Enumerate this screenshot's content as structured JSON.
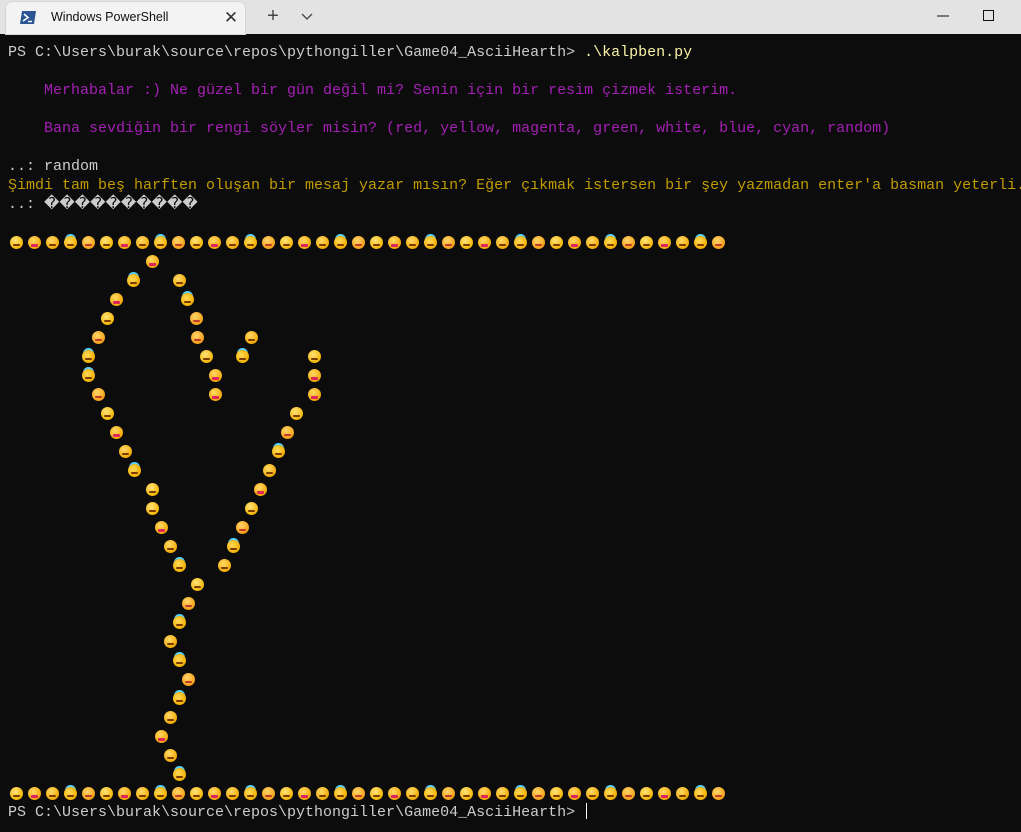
{
  "window": {
    "tab_title": "Windows PowerShell",
    "close_tab_label": "✕",
    "new_tab_label": "+",
    "icons": {
      "tab": "powershell-icon",
      "dropdown": "chevron-down-icon",
      "minimize": "minimize-icon",
      "maximize": "maximize-icon"
    }
  },
  "terminal": {
    "prompt_1": "PS C:\\Users\\burak\\source\\repos\\pythongiller\\Game04_AsciiHearth> ",
    "command": ".\\kalpben.py",
    "greeting": "    Merhabalar :) Ne güzel bir gün değil mi? Senin için bir resim çizmek isterim.",
    "color_question": "    Bana sevdiğin bir rengi söyler misin? (red, yellow, magenta, green, white, blue, cyan, random)",
    "color_answer": "..: random",
    "message_question": "Şimdi tam beş harften oluşan bir mesaj yazar mısın? Eğer çıkmak istersen bir şey yazmadan enter'a basman yeterli.",
    "message_answer": "..: ����������",
    "prompt_2": "PS C:\\Users\\burak\\source\\repos\\pythongiller\\Game04_AsciiHearth> "
  },
  "colors": {
    "background": "#0c0c0c",
    "prompt_text": "#cccccc",
    "command_text": "#f9f1a5",
    "greeting_text": "#a51fb6",
    "question_text": "#c19c00",
    "titlebar": "#e3e3e3"
  },
  "emoji_art": {
    "border_row_top": [
      "wink",
      "tongue",
      "eyes",
      "halo",
      "star",
      "wink",
      "tongue",
      "eyes",
      "halo",
      "star",
      "wink",
      "tongue",
      "eyes",
      "halo",
      "star",
      "wink",
      "tongue",
      "eyes",
      "halo",
      "star",
      "wink",
      "tongue",
      "eyes",
      "halo",
      "star",
      "wink",
      "tongue",
      "eyes",
      "halo",
      "star",
      "wink",
      "tongue",
      "eyes",
      "halo",
      "star",
      "wink",
      "tongue",
      "eyes",
      "halo",
      "star"
    ],
    "border_row_bottom": [
      "wink",
      "tongue",
      "eyes",
      "halo",
      "star",
      "wink",
      "tongue",
      "eyes",
      "halo",
      "star",
      "wink",
      "tongue",
      "eyes",
      "halo",
      "star",
      "wink",
      "tongue",
      "eyes",
      "halo",
      "star",
      "wink",
      "tongue",
      "eyes",
      "halo",
      "star",
      "wink",
      "tongue",
      "eyes",
      "halo",
      "star",
      "wink",
      "tongue",
      "eyes",
      "halo",
      "star",
      "wink",
      "tongue",
      "eyes",
      "halo",
      "star"
    ],
    "shape": [
      [
        "tongue"
      ],
      [
        "halo",
        "eyes"
      ],
      [
        "tongue",
        "halo"
      ],
      [
        "wink",
        "star"
      ],
      [
        "star",
        "star",
        "eyes"
      ],
      [
        "halo",
        "wink",
        "halo",
        "wink"
      ],
      [
        "halo",
        "tongue",
        "tongue"
      ],
      [
        "star",
        "tongue",
        "tongue"
      ],
      [
        "wink",
        "wink"
      ],
      [
        "tongue",
        "star"
      ],
      [
        "eyes",
        "halo"
      ],
      [
        "halo",
        "eyes"
      ],
      [
        "wink",
        "tongue"
      ],
      [
        "wink",
        "wink"
      ],
      [
        "tongue",
        "star"
      ],
      [
        "eyes",
        "halo"
      ],
      [
        "halo",
        "eyes"
      ],
      [
        "wink"
      ],
      [
        "star"
      ],
      [
        "halo"
      ],
      [
        "eyes"
      ],
      [
        "halo"
      ],
      [
        "star"
      ],
      [
        "halo"
      ],
      [
        "eyes"
      ],
      [
        "tongue"
      ],
      [
        "eyes"
      ],
      [
        "halo"
      ]
    ]
  }
}
